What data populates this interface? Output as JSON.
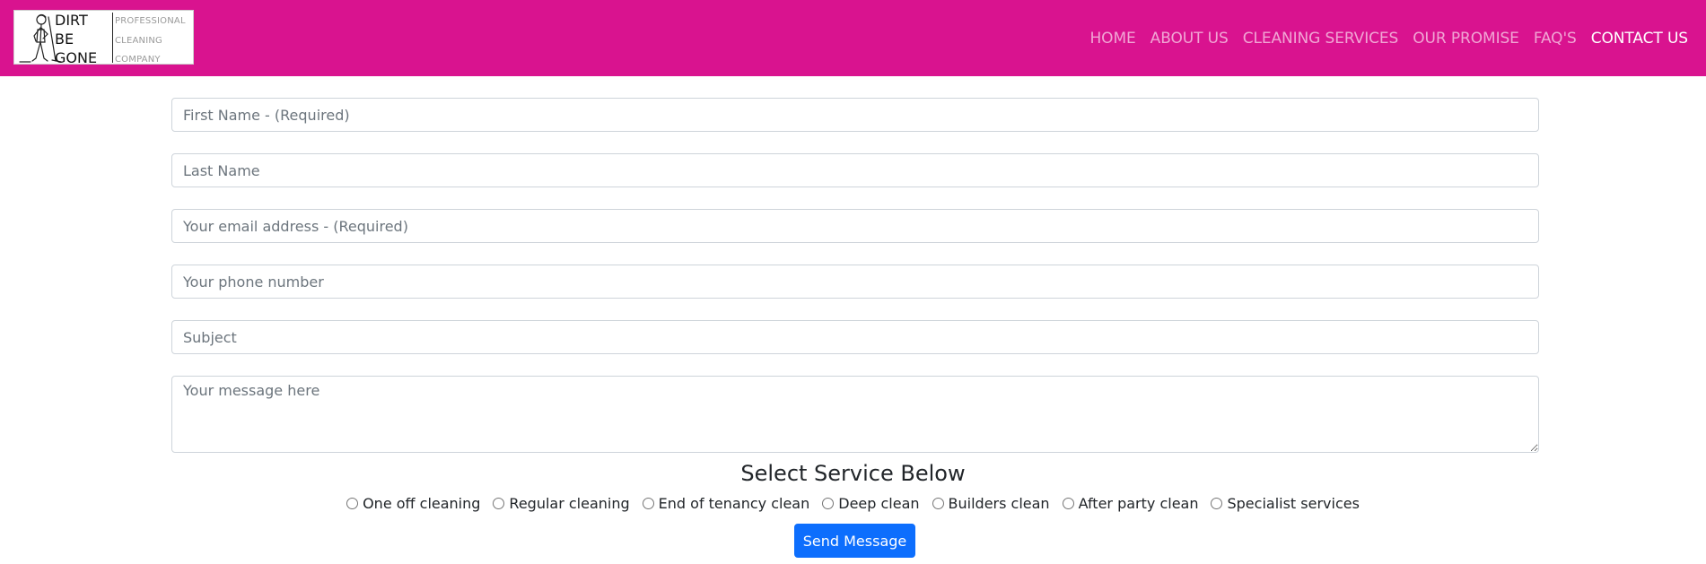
{
  "brand": {
    "title": "DIRT\nBE\nGONE",
    "subtitle": "PROFESSIONAL\nCLEANING\nCOMPANY",
    "bar_color": "#d9138f"
  },
  "nav": {
    "items": [
      {
        "label": "HOME",
        "active": false
      },
      {
        "label": "ABOUT US",
        "active": false
      },
      {
        "label": "CLEANING SERVICES",
        "active": false
      },
      {
        "label": "OUR PROMISE",
        "active": false
      },
      {
        "label": "FAQ'S",
        "active": false
      },
      {
        "label": "CONTACT US",
        "active": true
      }
    ]
  },
  "form": {
    "first_name_placeholder": "First Name - (Required)",
    "last_name_placeholder": "Last Name",
    "email_placeholder": "Your email address - (Required)",
    "phone_placeholder": "Your phone number",
    "subject_placeholder": "Subject",
    "message_placeholder": "Your message here",
    "service_heading": "Select Service Below",
    "services": [
      "One off cleaning",
      "Regular cleaning",
      "End of tenancy clean",
      "Deep clean",
      "Builders clean",
      "After party clean",
      "Specialist services"
    ],
    "submit_label": "Send Message",
    "submit_color": "#0d6efd"
  }
}
